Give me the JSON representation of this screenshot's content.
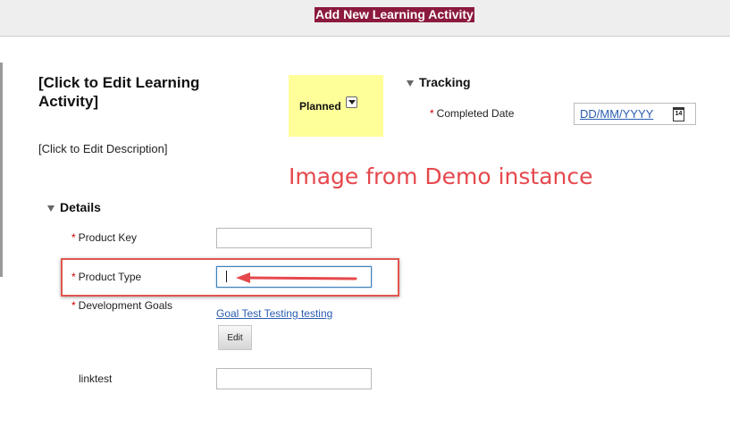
{
  "dialog": {
    "title": "Add New Learning Activity"
  },
  "activity": {
    "title": "[Click to Edit Learning Activity]",
    "description": "[Click to Edit Description]",
    "status": "Planned",
    "status_color": "#ffff99"
  },
  "tracking": {
    "header": "Tracking",
    "completed_date_label": "Completed Date",
    "completed_date_value": "DD/MM/YYYY",
    "calendar_day": "14"
  },
  "details": {
    "header": "Details",
    "product_key_label": "Product Key",
    "product_key_value": "",
    "product_type_label": "Product Type",
    "product_type_value": "",
    "development_goals_label": "Development Goals",
    "goal_link": "Goal Test Testing testing",
    "edit_label": "Edit",
    "linktest_label": "linktest",
    "linktest_value": ""
  },
  "annotation": {
    "text": "Image from Demo instance",
    "color": "#e5484d"
  },
  "required_mark": "*"
}
